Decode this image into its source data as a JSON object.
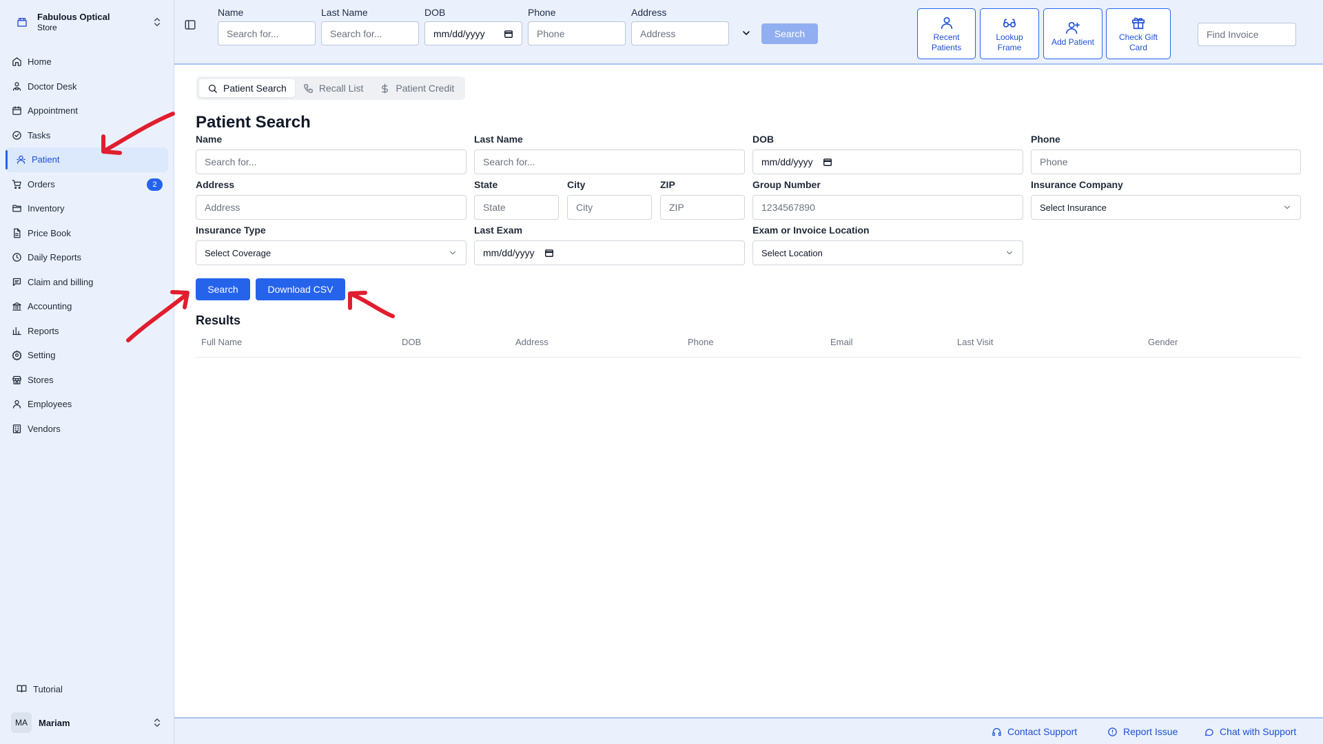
{
  "sidebar": {
    "store": {
      "name": "Fabulous Optical",
      "type": "Store"
    },
    "items": [
      {
        "label": "Home",
        "icon": "home-icon"
      },
      {
        "label": "Doctor Desk",
        "icon": "doctor-icon"
      },
      {
        "label": "Appointment",
        "icon": "calendar-icon"
      },
      {
        "label": "Tasks",
        "icon": "check-circle-icon"
      },
      {
        "label": "Patient",
        "icon": "patient-icon",
        "active": true
      },
      {
        "label": "Orders",
        "icon": "cart-icon",
        "badge": "2"
      },
      {
        "label": "Inventory",
        "icon": "folder-icon"
      },
      {
        "label": "Price Book",
        "icon": "document-icon"
      },
      {
        "label": "Daily Reports",
        "icon": "clock-icon"
      },
      {
        "label": "Claim and billing",
        "icon": "message-icon"
      },
      {
        "label": "Accounting",
        "icon": "bank-icon"
      },
      {
        "label": "Reports",
        "icon": "bar-chart-icon"
      },
      {
        "label": "Setting",
        "icon": "gear-icon"
      },
      {
        "label": "Stores",
        "icon": "store-icon"
      },
      {
        "label": "Employees",
        "icon": "user-icon"
      },
      {
        "label": "Vendors",
        "icon": "building-icon"
      }
    ],
    "tutorial": "Tutorial",
    "user": {
      "initials": "MA",
      "name": "Mariam"
    }
  },
  "topbar": {
    "fields": [
      {
        "label": "Name",
        "placeholder": "Search for..."
      },
      {
        "label": "Last Name",
        "placeholder": "Search for..."
      },
      {
        "label": "DOB",
        "placeholder": "mm/dd/yyyy"
      },
      {
        "label": "Phone",
        "placeholder": "Phone"
      },
      {
        "label": "Address",
        "placeholder": "Address"
      }
    ],
    "search_label": "Search",
    "actions": [
      {
        "label": "Recent Patients",
        "icon": "user-icon"
      },
      {
        "label": "Lookup Frame",
        "icon": "glasses-icon"
      },
      {
        "label": "Add Patient",
        "icon": "user-plus-icon"
      },
      {
        "label": "Check Gift Card",
        "icon": "gift-icon"
      }
    ],
    "find_invoice_placeholder": "Find Invoice"
  },
  "tabs": [
    {
      "label": "Patient Search",
      "icon": "search-icon",
      "active": true
    },
    {
      "label": "Recall List",
      "icon": "phone-icon"
    },
    {
      "label": "Patient Credit",
      "icon": "dollar-icon"
    }
  ],
  "form": {
    "title": "Patient Search",
    "name": {
      "label": "Name",
      "placeholder": "Search for..."
    },
    "last_name": {
      "label": "Last Name",
      "placeholder": "Search for..."
    },
    "dob": {
      "label": "DOB",
      "placeholder": "mm/dd/yyyy"
    },
    "phone": {
      "label": "Phone",
      "placeholder": "Phone"
    },
    "address": {
      "label": "Address",
      "placeholder": "Address"
    },
    "state": {
      "label": "State",
      "placeholder": "State"
    },
    "city": {
      "label": "City",
      "placeholder": "City"
    },
    "zip": {
      "label": "ZIP",
      "placeholder": "ZIP"
    },
    "group_number": {
      "label": "Group Number",
      "placeholder": "1234567890"
    },
    "insurance_company": {
      "label": "Insurance Company",
      "value": "Select Insurance"
    },
    "insurance_type": {
      "label": "Insurance Type",
      "value": "Select Coverage"
    },
    "last_exam": {
      "label": "Last Exam",
      "placeholder": "mm/dd/yyyy"
    },
    "location": {
      "label": "Exam or Invoice Location",
      "value": "Select Location"
    },
    "search_label": "Search",
    "download_label": "Download CSV"
  },
  "results": {
    "title": "Results",
    "columns": [
      "Full Name",
      "DOB",
      "Address",
      "Phone",
      "Email",
      "Last Visit",
      "Gender"
    ]
  },
  "footer": {
    "contact": "Contact Support",
    "report": "Report Issue",
    "chat": "Chat with Support"
  },
  "colors": {
    "accent": "#2563eb",
    "chrome_bg": "#eaf1fd",
    "annotation": "#e11d2e"
  }
}
